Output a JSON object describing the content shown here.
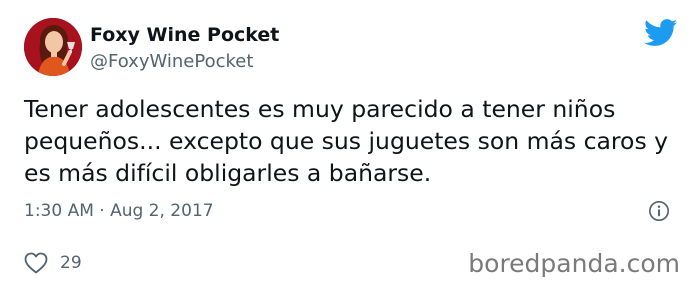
{
  "author": {
    "display_name": "Foxy Wine Pocket",
    "handle": "@FoxyWinePocket",
    "avatar_icon": "profile-avatar"
  },
  "platform_icon": "twitter-bird-icon",
  "tweet": {
    "text": "Tener adolescentes es muy parecido a tener niños pequeños... excepto que sus juguetes son más caros y es más difícil obligarles a bañarse.",
    "timestamp": "1:30 AM · Aug 2, 2017"
  },
  "engagement": {
    "like_count": "29",
    "like_icon": "heart-icon"
  },
  "watermark": "boredpanda.com",
  "colors": {
    "twitter_blue": "#1d9bf0",
    "secondary_text": "#536471",
    "primary_text": "#0f1419",
    "avatar_background": "#a8121e"
  }
}
